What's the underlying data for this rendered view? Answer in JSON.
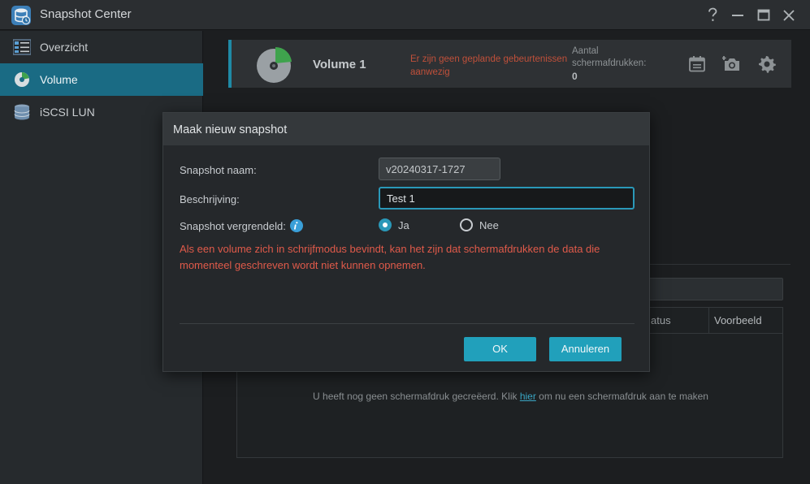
{
  "window": {
    "title": "Snapshot Center"
  },
  "sidebar": {
    "items": [
      {
        "label": "Overzicht"
      },
      {
        "label": "Volume"
      },
      {
        "label": "iSCSI LUN"
      }
    ]
  },
  "volume_header": {
    "name": "Volume 1",
    "warning": "Er zijn geen geplande gebeurtenissen aanwezig",
    "count_label": "Aantal schermafdrukken:",
    "count_value": "0"
  },
  "background_table": {
    "columns": [
      "Status",
      "Voorbeeld"
    ],
    "column_status_visible": "atus",
    "empty_prefix": "U heeft nog geen schermafdruk gecreëerd. Klik ",
    "empty_link": "hier",
    "empty_suffix": " om nu een schermafdruk aan te maken"
  },
  "dialog": {
    "title": "Maak nieuw snapshot",
    "name_label": "Snapshot naam:",
    "name_value": "v20240317-1727",
    "desc_label": "Beschrijving:",
    "desc_value": "Test 1",
    "lock_label": "Snapshot vergrendeld:",
    "option_yes": "Ja",
    "option_no": "Nee",
    "selected_option": "Ja",
    "warning": "Als een volume zich in schrijfmodus bevindt, kan het zijn dat schermafdrukken de data die momenteel geschreven wordt niet kunnen opnemen.",
    "ok_label": "OK",
    "cancel_label": "Annuleren"
  },
  "colors": {
    "accent": "#21a0bb",
    "active_sidebar": "#1a6b84",
    "warning_red": "#e05a4a"
  }
}
